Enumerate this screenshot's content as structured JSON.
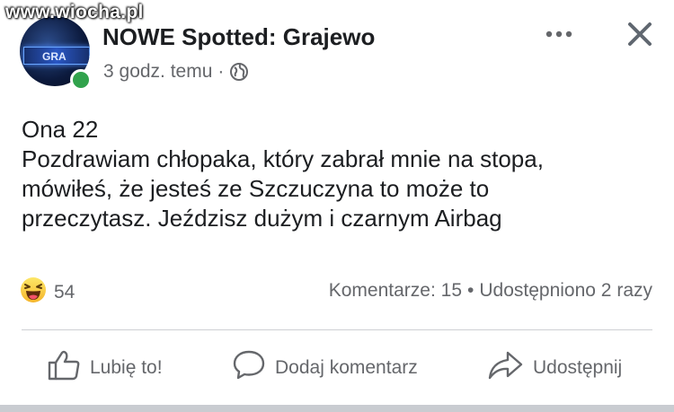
{
  "watermark": "www.wiocha.pl",
  "post": {
    "page_name": "NOWE Spotted: Grajewo",
    "avatar_sign": "GRA",
    "time": "3 godz. temu",
    "separator": "·",
    "privacy_icon": "globe-icon",
    "lines": [
      "Ona 22",
      "Pozdrawiam chłopaka, który zabrał mnie na stopa,",
      "mówiłeś, że jesteś ze Szczuczyna to może to",
      "przeczytasz. Jeździsz dużym i czarnym Airbag"
    ]
  },
  "engagement": {
    "reaction_icon": "haha-emoji-icon",
    "reaction_count": "54",
    "comments": "Komentarze: 15",
    "dot": "•",
    "shares": "Udostępniono 2 razy"
  },
  "actions": {
    "like": "Lubię to!",
    "comment": "Dodaj komentarz",
    "share": "Udostępnij"
  },
  "colors": {
    "text": "#1c1e21",
    "secondary": "#65676b",
    "online": "#31a24c",
    "divider": "#ced0d4"
  }
}
